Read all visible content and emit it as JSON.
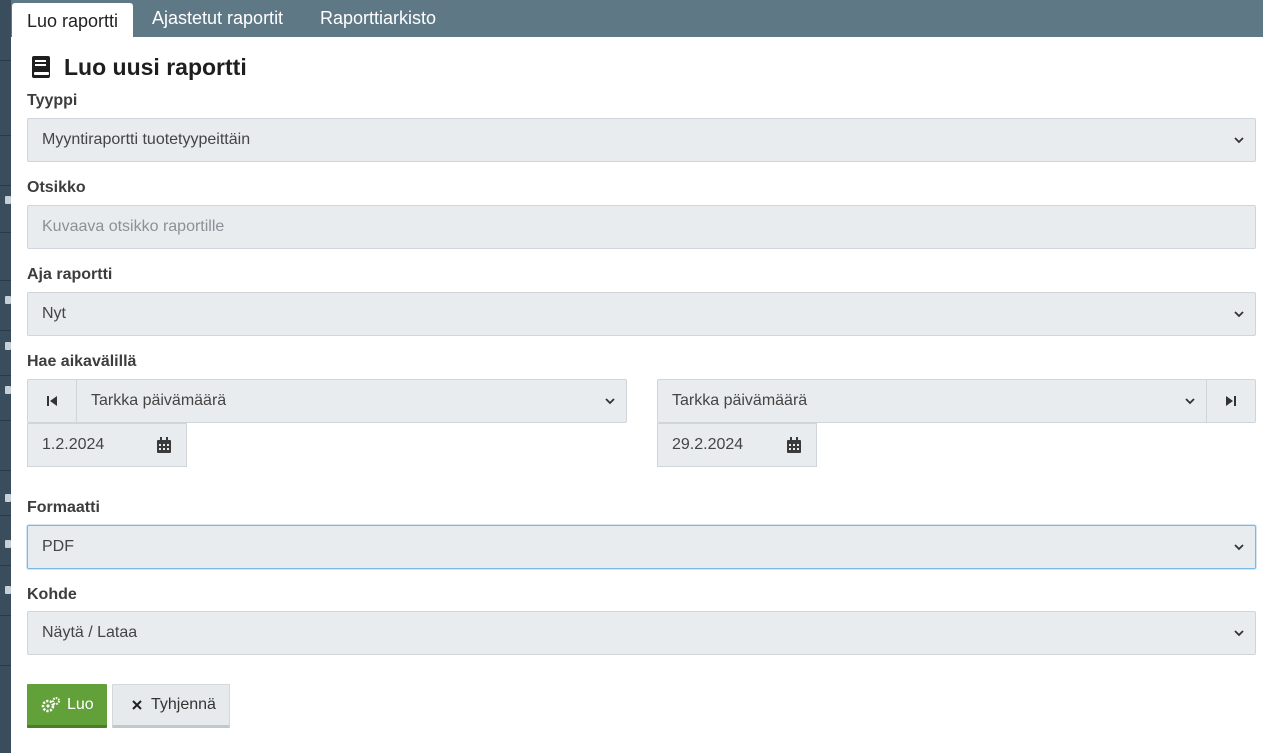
{
  "tabs": [
    {
      "label": "Luo raportti",
      "active": true
    },
    {
      "label": "Ajastetut raportit",
      "active": false
    },
    {
      "label": "Raporttiarkisto",
      "active": false
    }
  ],
  "page_title": "Luo uusi raportti",
  "form": {
    "type": {
      "label": "Tyyppi",
      "value": "Myyntiraportti tuotetyypeittäin"
    },
    "title": {
      "label": "Otsikko",
      "value": "",
      "placeholder": "Kuvaava otsikko raportille"
    },
    "run": {
      "label": "Aja raportti",
      "value": "Nyt"
    },
    "range": {
      "label": "Hae aikavälillä",
      "start_mode": "Tarkka päivämäärä",
      "start_date": "1.2.2024",
      "end_mode": "Tarkka päivämäärä",
      "end_date": "29.2.2024"
    },
    "format": {
      "label": "Formaatti",
      "value": "PDF"
    },
    "target": {
      "label": "Kohde",
      "value": "Näytä / Lataa"
    }
  },
  "buttons": {
    "create": "Luo",
    "clear": "Tyhjennä"
  },
  "colors": {
    "tabbar": "#5f7886",
    "field_bg": "#e9ecef",
    "create_button": "#62a03a",
    "focus_border": "#7ab8e8"
  },
  "icons": {
    "title": "book-icon",
    "range_start": "step-backward-icon",
    "range_end": "step-forward-icon",
    "date": "calendar-icon",
    "create": "gears-icon",
    "clear": "times-icon",
    "select": "chevron-down-icon"
  }
}
